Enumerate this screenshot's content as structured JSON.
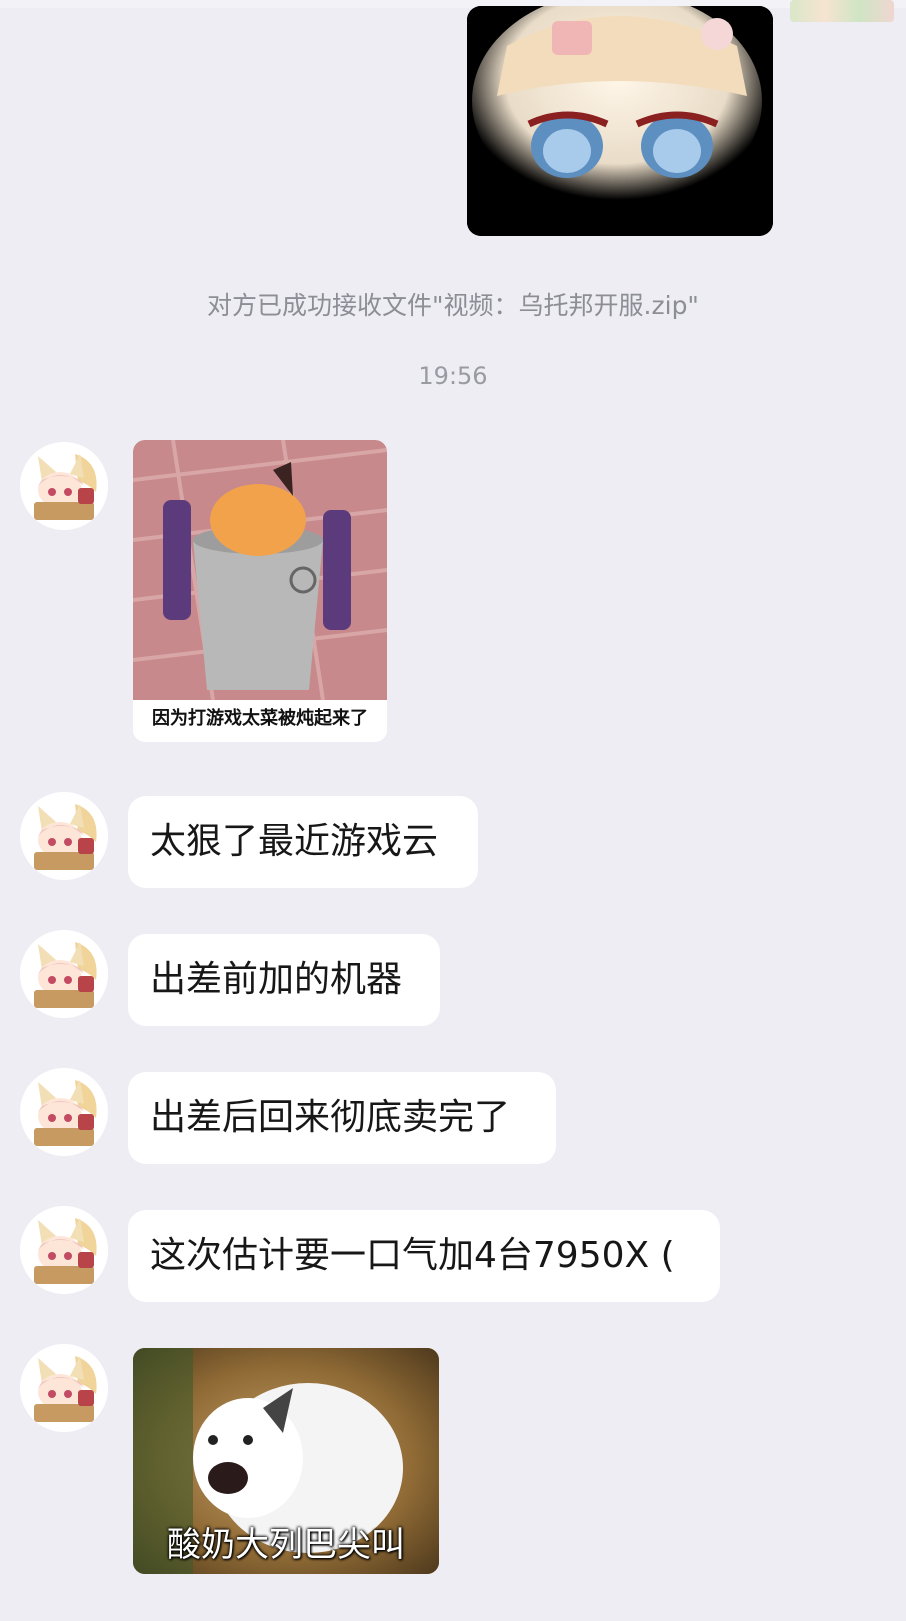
{
  "system": {
    "file_notice": "对方已成功接收文件\"视频：乌托邦开服.zip\"",
    "timestamp": "19:56"
  },
  "messages": [
    {
      "kind": "sticker",
      "caption": "因为打游戏太菜被炖起来了",
      "icon": "fox-in-bucket-sticker"
    },
    {
      "kind": "text",
      "text": "太狠了最近游戏云"
    },
    {
      "kind": "text",
      "text": "出差前加的机器"
    },
    {
      "kind": "text",
      "text": "出差后回来彻底卖完了"
    },
    {
      "kind": "text",
      "text": "这次估计要一口气加4台7950X ("
    },
    {
      "kind": "sticker",
      "caption": "酸奶大列巴尖叫",
      "icon": "screaming-white-fox-sticker"
    }
  ],
  "colors": {
    "background": "#ededf3",
    "bubble": "#ffffff",
    "system_text": "#8d8d96"
  }
}
